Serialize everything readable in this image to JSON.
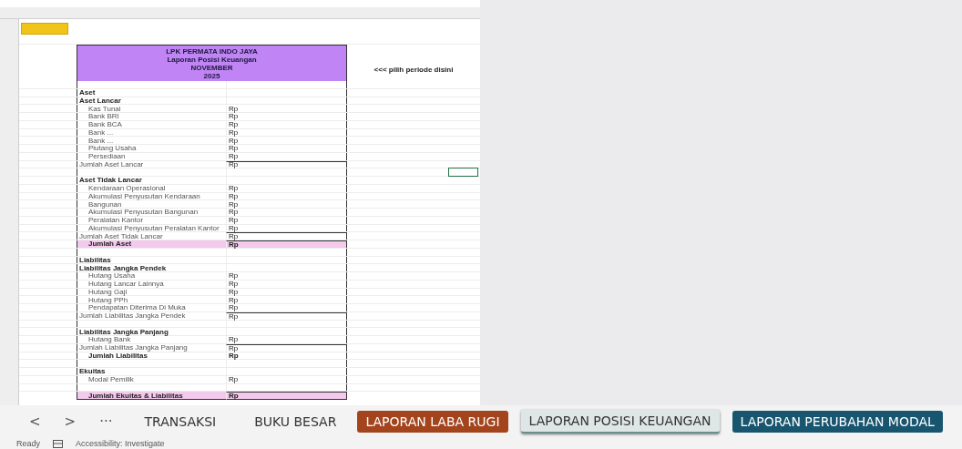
{
  "statement": {
    "title_lines": [
      "LPK PERMATA INDO JAYA",
      "Laporan Posisi Keuangan",
      "NOVEMBER",
      "2025"
    ],
    "period_note": "<<< pilih periode disini",
    "rows": [
      {
        "kind": "blank"
      },
      {
        "kind": "section",
        "label": "Aset"
      },
      {
        "kind": "section",
        "label": "Aset Lancar"
      },
      {
        "kind": "item",
        "label": "Kas Tunai",
        "value": "Rp"
      },
      {
        "kind": "item",
        "label": "Bank BRI",
        "value": "Rp"
      },
      {
        "kind": "item",
        "label": "Bank BCA",
        "value": "Rp"
      },
      {
        "kind": "item",
        "label": "Bank ...",
        "value": "Rp"
      },
      {
        "kind": "item",
        "label": "Bank ...",
        "value": "Rp"
      },
      {
        "kind": "item",
        "label": "Piutang Usaha",
        "value": "Rp"
      },
      {
        "kind": "item",
        "label": "Persediaan",
        "value": "Rp"
      },
      {
        "kind": "subtotal",
        "label": "Jumlah Aset Lancar",
        "value": "Rp"
      },
      {
        "kind": "blank",
        "selected_cell": true
      },
      {
        "kind": "section",
        "label": "Aset Tidak Lancar"
      },
      {
        "kind": "item",
        "label": "Kendaraan Operasional",
        "value": "Rp"
      },
      {
        "kind": "item",
        "label": "Akumulasi Penyusutan Kendaraan",
        "value": "Rp"
      },
      {
        "kind": "item",
        "label": "Bangunan",
        "value": "Rp"
      },
      {
        "kind": "item",
        "label": "Akumulasi Penyusutan Bangunan",
        "value": "Rp"
      },
      {
        "kind": "item",
        "label": "Peralatan Kantor",
        "value": "Rp"
      },
      {
        "kind": "item",
        "label": "Akumulasi Penyusutan Peralatan Kantor",
        "value": "Rp"
      },
      {
        "kind": "subtotal",
        "label": "Jumlah Aset Tidak Lancar",
        "value": "Rp"
      },
      {
        "kind": "total",
        "label": "Jumlah Aset",
        "value": "Rp"
      },
      {
        "kind": "blank"
      },
      {
        "kind": "section",
        "label": "Liabilitas"
      },
      {
        "kind": "section",
        "label": "Liabilitas Jangka Pendek"
      },
      {
        "kind": "item",
        "label": "Hutang Usaha",
        "value": "Rp"
      },
      {
        "kind": "item",
        "label": "Hutang Lancar Lainnya",
        "value": "Rp"
      },
      {
        "kind": "item",
        "label": "Hutang Gaji",
        "value": "Rp"
      },
      {
        "kind": "item",
        "label": "Hutang PPh",
        "value": "Rp"
      },
      {
        "kind": "item",
        "label": "Pendapatan Diterima Di Muka",
        "value": "Rp"
      },
      {
        "kind": "subtotal",
        "label": "Jumlah Liabilitas Jangka Pendek",
        "value": "Rp"
      },
      {
        "kind": "blank"
      },
      {
        "kind": "section",
        "label": "Liabilitas Jangka Panjang"
      },
      {
        "kind": "item",
        "label": "Hutang Bank",
        "value": "Rp"
      },
      {
        "kind": "subtotal",
        "label": "Jumlah Liabilitas Jangka Panjang",
        "value": "Rp"
      },
      {
        "kind": "emph",
        "label": "Jumlah Liabilitas",
        "value": "Rp"
      },
      {
        "kind": "blank"
      },
      {
        "kind": "section",
        "label": "Ekuitas"
      },
      {
        "kind": "item",
        "label": "Modal Pemilik",
        "value": "Rp"
      },
      {
        "kind": "blank"
      },
      {
        "kind": "total",
        "label": "Jumlah Ekuitas & Liabilitas",
        "value": "Rp"
      }
    ]
  },
  "sheet_tabs": {
    "nav": [
      "<",
      ">",
      "···"
    ],
    "tabs": [
      {
        "label": "TRANSAKSI",
        "selected": false,
        "color": "#f3f3f3"
      },
      {
        "label": "BUKU BESAR",
        "selected": false,
        "color": "#f3f3f3"
      },
      {
        "label": "LAPORAN LABA RUGI",
        "selected": false,
        "color": "#a3441d"
      },
      {
        "label": "LAPORAN POSISI KEUANGAN",
        "selected": true,
        "color": "#dfe6e6"
      },
      {
        "label": "LAPORAN PERUBAHAN MODAL",
        "selected": false,
        "color": "#185670"
      }
    ]
  },
  "status_bar": {
    "mode": "Ready",
    "accessibility": "Accessibility: Investigate"
  }
}
